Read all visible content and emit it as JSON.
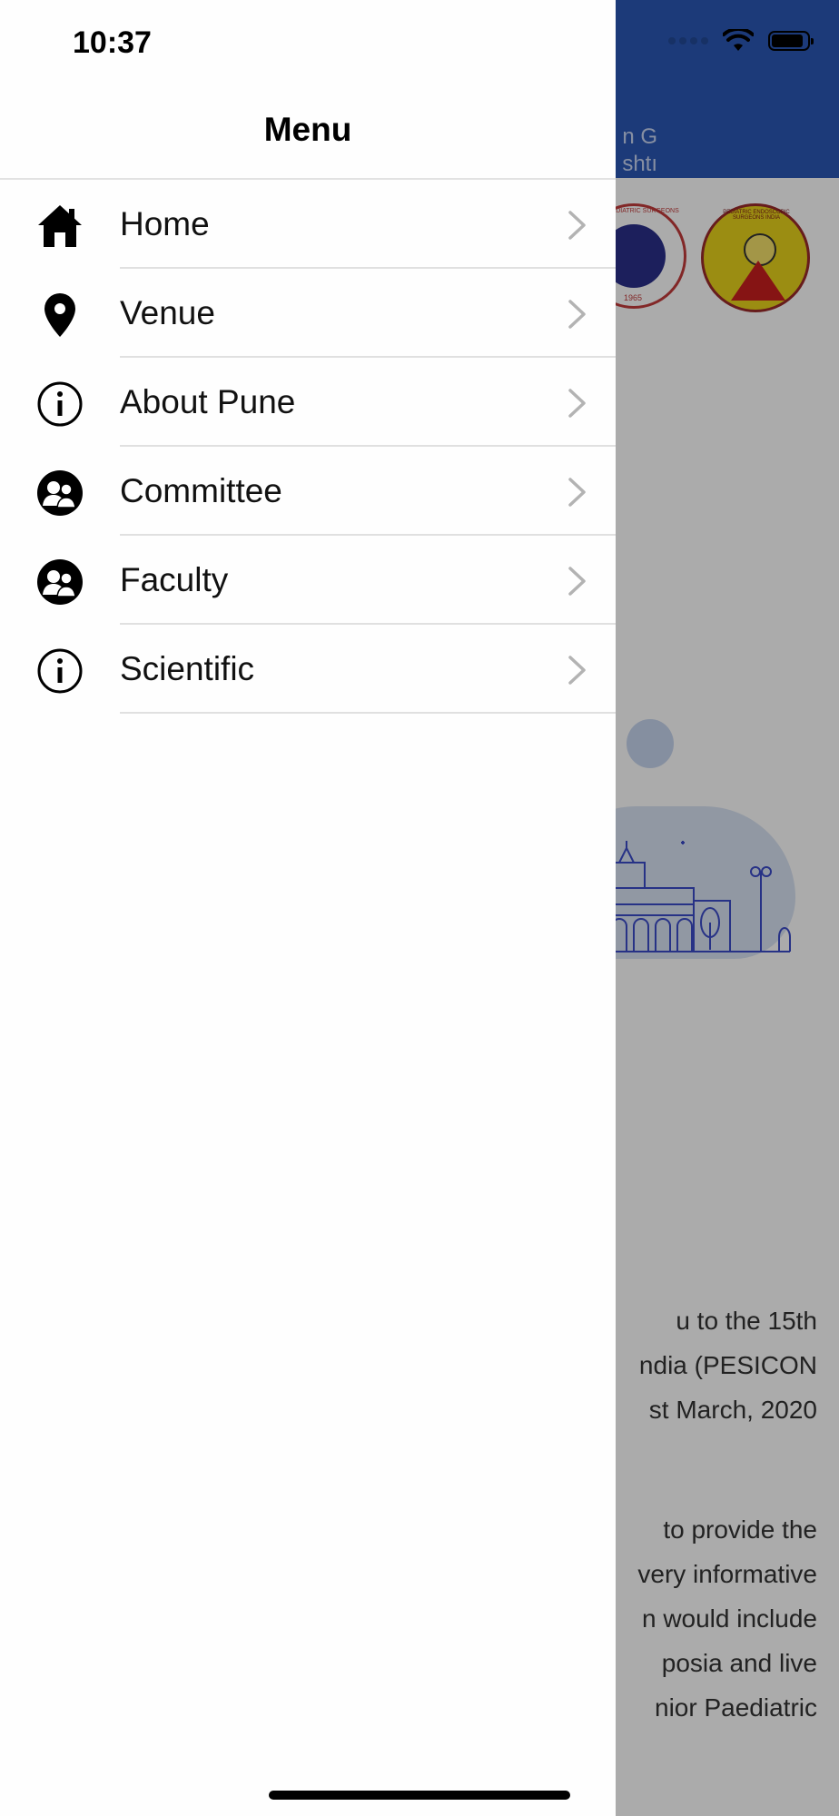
{
  "status_bar": {
    "time": "10:37"
  },
  "background_app": {
    "header_line_1": "n G",
    "header_line_2": "shtı",
    "paragraph_1": [
      "u  to  the  15th",
      "ndia  (PESICON",
      "st March, 2020"
    ],
    "paragraph_2": [
      "  to  provide  the",
      "very informative",
      "n  would  include",
      "posia  and  live",
      "nior   Paediatric"
    ],
    "badge_2_label": "PEDIATRIC ENDOSCOPIC SURGEONS INDIA",
    "badge_1_label": "N OF PEDIATRIC SURGEONS",
    "badge_1_year": "1965"
  },
  "drawer": {
    "title": "Menu",
    "items": [
      {
        "label": "Home",
        "icon": "home-icon"
      },
      {
        "label": "Venue",
        "icon": "location-pin-icon"
      },
      {
        "label": "About Pune",
        "icon": "info-icon"
      },
      {
        "label": "Committee",
        "icon": "people-icon"
      },
      {
        "label": "Faculty",
        "icon": "people-icon"
      },
      {
        "label": "Scientific",
        "icon": "info-icon"
      }
    ]
  },
  "colors": {
    "header_blue": "#2a57b5",
    "scrim": "rgba(0,0,0,0.33)",
    "drawer_bg": "#fefefe",
    "chevron": "#b3b3b3"
  }
}
